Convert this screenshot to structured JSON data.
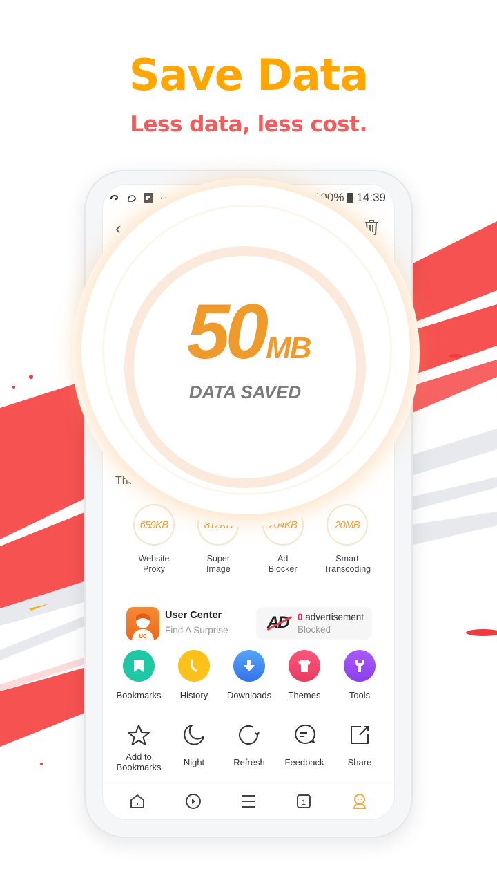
{
  "promo": {
    "headline": "Save Data",
    "subline": "Less data, less cost.",
    "colors": {
      "headline": "#ffa700",
      "subline": "#f35c5c",
      "brush": "#f54747"
    }
  },
  "status_bar": {
    "battery_percent": "100%",
    "time": "14:39",
    "more_glyph": "···"
  },
  "top_bar": {
    "back_glyph": "‹"
  },
  "savings": {
    "total_value": "50",
    "total_unit": "MB",
    "total_label": "DATA SAVED",
    "intro_text": "The",
    "breakdown": [
      {
        "value": "659KB",
        "label_line1": "Website",
        "label_line2": "Proxy"
      },
      {
        "value": "812KB",
        "label_line1": "Super",
        "label_line2": "Image"
      },
      {
        "value": "204KB",
        "label_line1": "Ad",
        "label_line2": "Blocker"
      },
      {
        "value": "20MB",
        "label_line1": "Smart",
        "label_line2": "Transcoding"
      }
    ]
  },
  "user_center": {
    "title": "User Center",
    "subtitle": "Find A Surprise",
    "avatar_badge": "UC"
  },
  "ad_block": {
    "logo": "AD",
    "count": "0",
    "count_suffix": " advertisement",
    "status": "Blocked"
  },
  "quick_actions": [
    {
      "label": "Bookmarks",
      "icon": "bookmark-icon",
      "color": "#1ec8a4"
    },
    {
      "label": "History",
      "icon": "clock-icon",
      "color": "#fcc21b"
    },
    {
      "label": "Downloads",
      "icon": "download-icon",
      "color": "#3f8ef3"
    },
    {
      "label": "Themes",
      "icon": "shirt-icon",
      "color": "#f2466e"
    },
    {
      "label": "Tools",
      "icon": "wrench-icon",
      "color": "#9a4ef0"
    }
  ],
  "menu_actions": [
    {
      "label": "Add to Bookmarks",
      "icon": "star-icon"
    },
    {
      "label": "Night",
      "icon": "moon-icon"
    },
    {
      "label": "Refresh",
      "icon": "refresh-icon"
    },
    {
      "label": "Feedback",
      "icon": "feedback-icon"
    },
    {
      "label": "Share",
      "icon": "share-icon"
    }
  ],
  "bottom_nav": {
    "items": [
      {
        "name": "home",
        "icon": "home-icon"
      },
      {
        "name": "video",
        "icon": "play-icon"
      },
      {
        "name": "menu",
        "icon": "menu-icon"
      },
      {
        "name": "tabs",
        "icon": "tabs-icon",
        "tab_count": "1"
      },
      {
        "name": "profile",
        "icon": "profile-icon",
        "active": true,
        "color": "#f0a742"
      }
    ]
  }
}
